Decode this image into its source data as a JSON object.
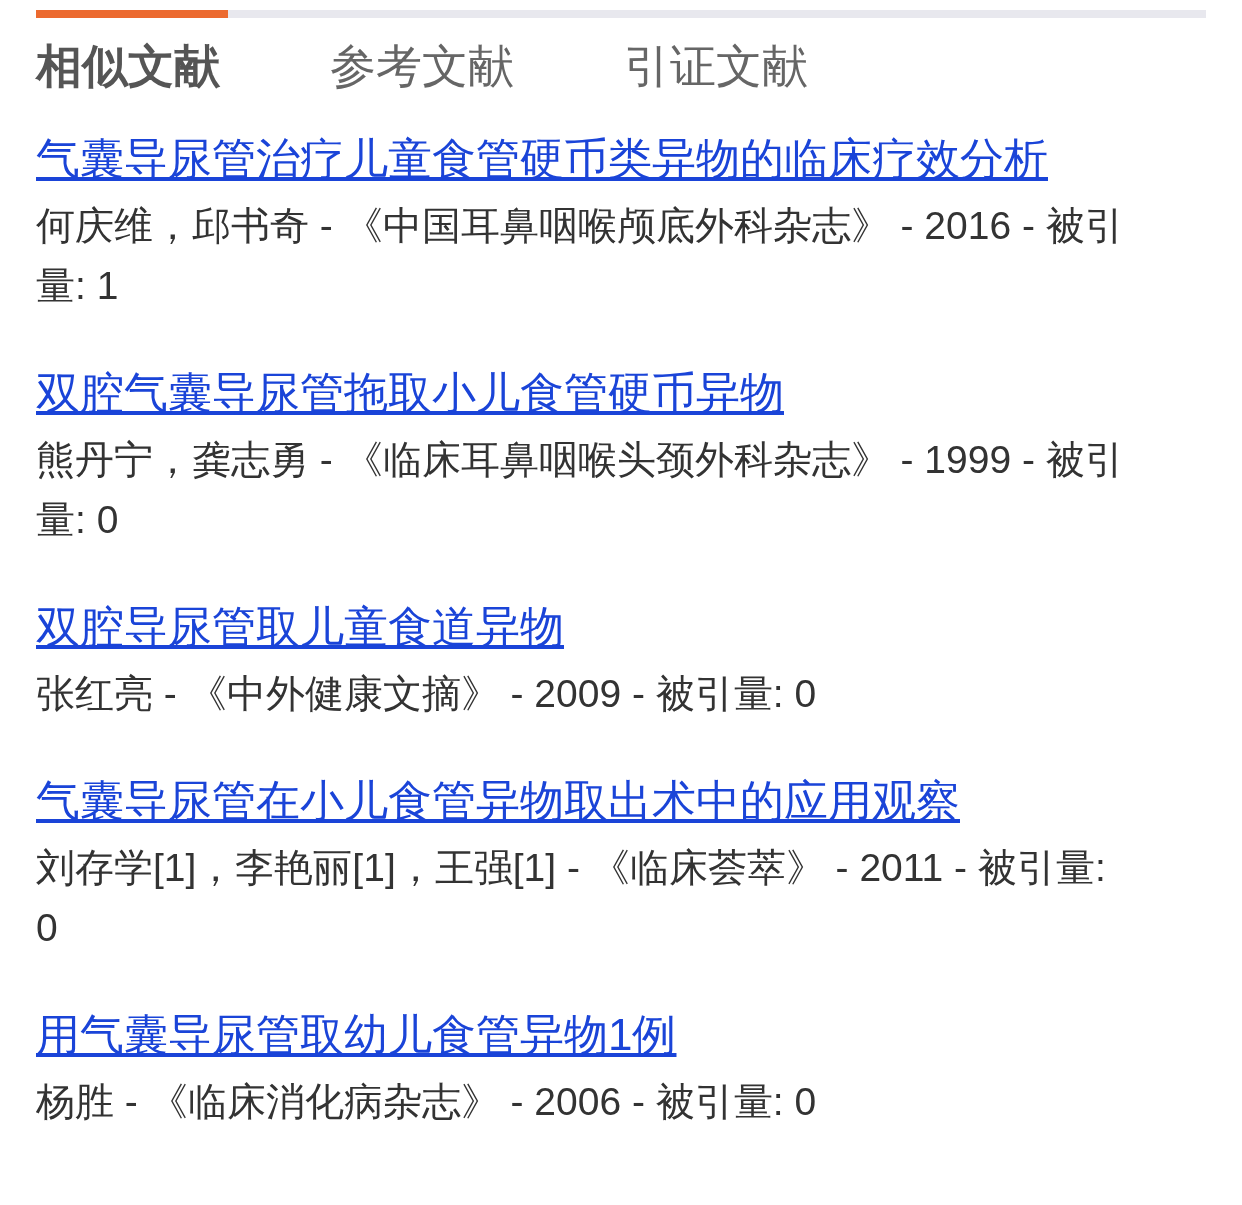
{
  "progress": {
    "level": 0.164
  },
  "tabs": [
    {
      "label": "相似文献",
      "selected": true
    },
    {
      "label": "参考文献",
      "selected": false
    },
    {
      "label": "引证文献",
      "selected": false
    }
  ],
  "articles": [
    {
      "title": "气囊导尿管治疗儿童食管硬币类异物的临床疗效分析",
      "meta": "何庆维，邱书奇 - 《中国耳鼻咽喉颅底外科杂志》 - 2016 - 被引量: 1"
    },
    {
      "title": "双腔气囊导尿管拖取小儿食管硬币异物",
      "meta": "熊丹宁，龚志勇 - 《临床耳鼻咽喉头颈外科杂志》 - 1999 - 被引量: 0"
    },
    {
      "title": "双腔导尿管取儿童食道异物",
      "meta": "张红亮 - 《中外健康文摘》 - 2009 - 被引量: 0"
    },
    {
      "title": "气囊导尿管在小儿食管异物取出术中的应用观察",
      "meta": "刘存学[1]，李艳丽[1]，王强[1] - 《临床荟萃》 - 2011 - 被引量: 0"
    },
    {
      "title": "用气囊导尿管取幼儿食管异物1例",
      "meta": "杨胜 - 《临床消化病杂志》 - 2006 - 被引量: 0"
    }
  ]
}
